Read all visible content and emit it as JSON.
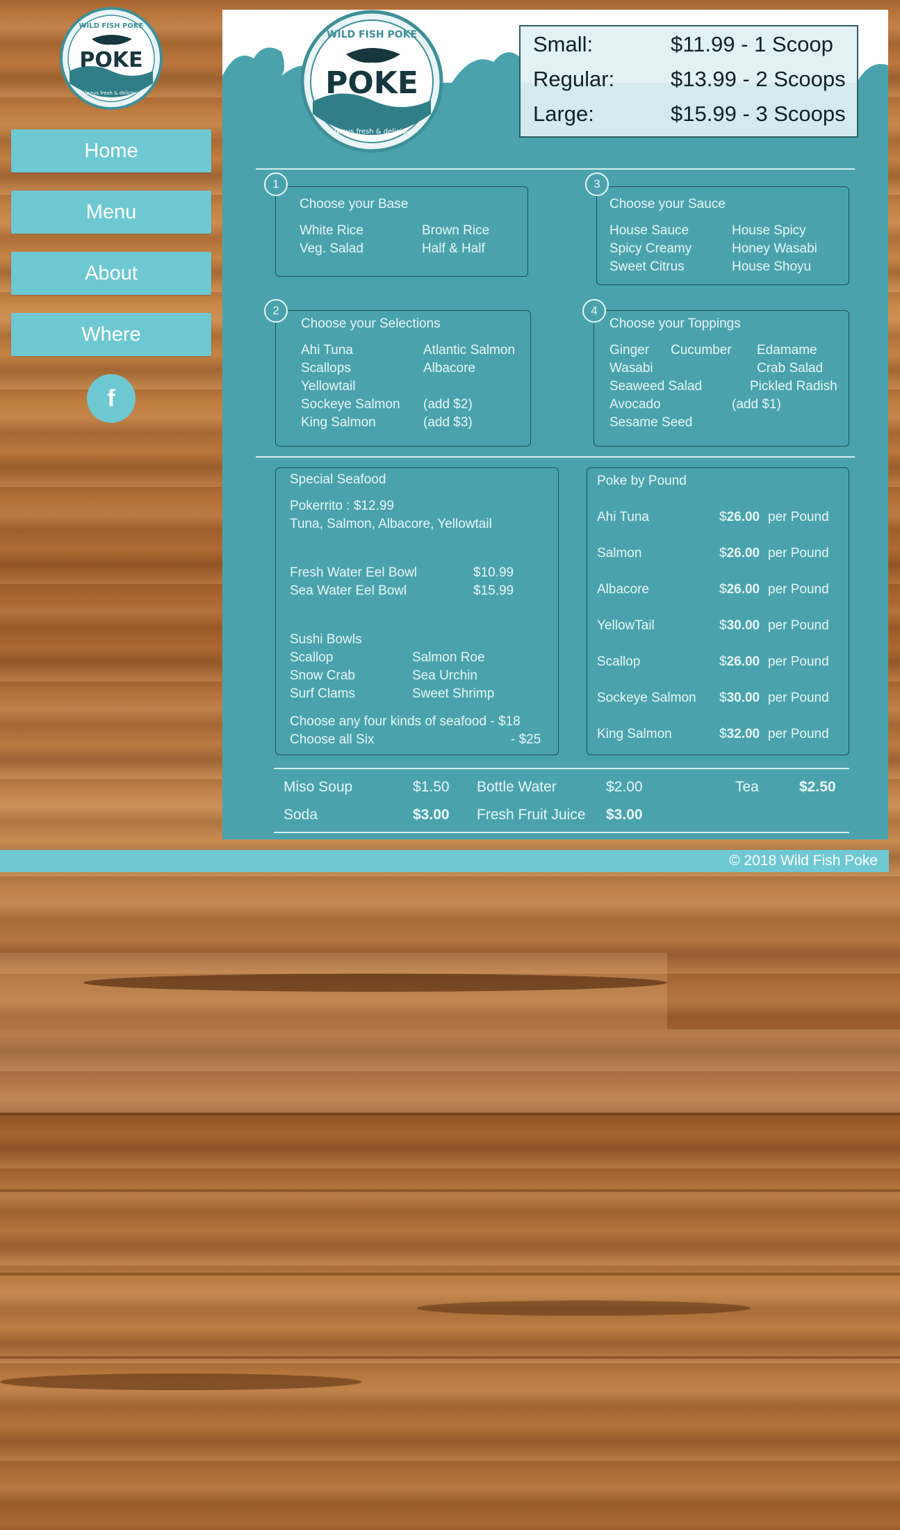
{
  "brand": {
    "logo_top_text": "WILD FISH POKE",
    "logo_main_text": "POKE",
    "logo_tagline": "Always fresh & delicious"
  },
  "nav": {
    "items": [
      {
        "label": "Home"
      },
      {
        "label": "Menu"
      },
      {
        "label": "About"
      },
      {
        "label": "Where"
      }
    ],
    "social_icon": "facebook-icon",
    "social_glyph": "f"
  },
  "sizes": [
    {
      "label": "Small:",
      "price": "$11.99 - 1 Scoop"
    },
    {
      "label": "Regular:",
      "price": "$13.99 - 2 Scoops"
    },
    {
      "label": "Large:",
      "price": "$15.99 - 3 Scoops"
    }
  ],
  "steps": {
    "base": {
      "number": "1",
      "title": "Choose your Base",
      "col1": [
        "White Rice",
        "Veg. Salad"
      ],
      "col2": [
        "Brown Rice",
        "Half & Half"
      ]
    },
    "sauce": {
      "number": "3",
      "title": "Choose your Sauce",
      "col1": [
        "House Sauce",
        "Spicy Creamy",
        "Sweet Citrus"
      ],
      "col2": [
        "House Spicy",
        "Honey Wasabi",
        "House Shoyu"
      ]
    },
    "selections": {
      "number": "2",
      "title": "Choose your Selections",
      "col1": [
        "Ahi Tuna",
        "Scallops",
        "Yellowtail",
        "Sockeye Salmon",
        "King Salmon"
      ],
      "col2": [
        "Atlantic Salmon",
        "Albacore",
        "",
        "(add $2)",
        "(add $3)"
      ]
    },
    "toppings": {
      "number": "4",
      "title": "Choose your Toppings",
      "rows": [
        [
          "Ginger",
          "Cucumber",
          "Edamame"
        ],
        [
          "Wasabi",
          "",
          "Crab Salad"
        ],
        [
          "Seaweed Salad",
          "",
          "Pickled Radish"
        ],
        [
          "Avocado",
          "(add $1)",
          ""
        ],
        [
          "Sesame Seed",
          "",
          ""
        ]
      ]
    }
  },
  "special": {
    "title": "Special Seafood",
    "pokerrito": "Pokerrito : $12.99",
    "pokerrito_desc": "Tuna, Salmon, Albacore, Yellowtail",
    "eel": [
      {
        "name": "Fresh Water Eel Bowl",
        "price": "$10.99"
      },
      {
        "name": "Sea Water Eel Bowl",
        "price": "$15.99"
      }
    ],
    "sushi_title": "Sushi Bowls",
    "sushi_col1": [
      "Scallop",
      "Snow Crab",
      "Surf Clams"
    ],
    "sushi_col2": [
      "Salmon Roe",
      "Sea Urchin",
      "Sweet Shrimp"
    ],
    "choose_four": "Choose any four kinds of seafood - $18",
    "choose_all": "Choose all Six",
    "choose_all_price": "- $25"
  },
  "pound": {
    "title": "Poke by Pound",
    "unit": "per Pound",
    "items": [
      {
        "name": "Ahi Tuna",
        "price": "26.00"
      },
      {
        "name": "Salmon",
        "price": "26.00"
      },
      {
        "name": "Albacore",
        "price": "26.00"
      },
      {
        "name": "YellowTail",
        "price": "30.00"
      },
      {
        "name": "Scallop",
        "price": "26.00"
      },
      {
        "name": "Sockeye Salmon",
        "price": "30.00"
      },
      {
        "name": "King Salmon",
        "price": "32.00"
      }
    ]
  },
  "drinks": [
    {
      "name": "Miso Soup",
      "price": "$1.50"
    },
    {
      "name": "Bottle Water",
      "price": "$2.00"
    },
    {
      "name": "Tea",
      "price": "$2.50"
    },
    {
      "name": "Soda",
      "price": "$3.00"
    },
    {
      "name": "Fresh Fruit Juice",
      "price": "$3.00"
    }
  ],
  "footer": {
    "copyright": "© 2018 Wild Fish Poke"
  },
  "colors": {
    "accent": "#6ec8d2",
    "menu_bg": "#4aa3ac",
    "dark": "#1e4d54"
  }
}
